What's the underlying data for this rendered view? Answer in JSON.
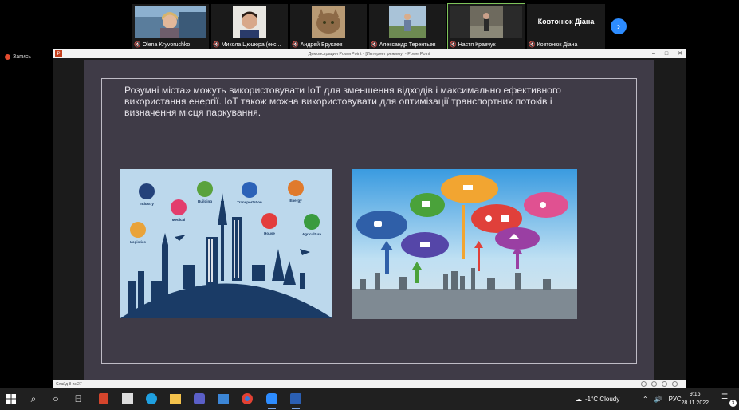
{
  "participants": [
    {
      "name": "Olena Kryvoruchko",
      "muted": true
    },
    {
      "name": "Микола Цюцюра (екс...",
      "muted": true
    },
    {
      "name": "Андрей Брукаев",
      "muted": true
    },
    {
      "name": "Александр Терентьев",
      "muted": true
    },
    {
      "name": "Настя Кравчук",
      "muted": true
    }
  ],
  "highlighted_participant": {
    "big_name": "Ковтонюк Діана",
    "small_name": "Ковтонюк Діана"
  },
  "record_label": "Запись",
  "ppt": {
    "window_title": "Демонстрация PowerPoint - [Интернет режиму] - PowerPoint",
    "status_text": "Слайд 8 из 27",
    "slide_text": "Розумні міста» можуть використовувати IoT для зменшення відходів і максимально ефективного використання енергії. IoT також можна використовувати для оптимізації транспортних потоків і визначення місця паркування.",
    "left_image_labels": {
      "industry": "Industry",
      "building": "Building",
      "transportation": "Transportation",
      "energy": "Energy",
      "medical": "Medical",
      "house": "House",
      "logistics": "Logistics",
      "agriculture": "Agriculture"
    }
  },
  "taskbar": {
    "weather": "-1°C Cloudy",
    "language": "РУС",
    "time": "9:16",
    "date": "28.11.2022",
    "notifications": "3"
  },
  "colors": {
    "slide_bg": "#3f3b47",
    "zoom_blue": "#2d8cff",
    "ppt_red": "#c43e1c"
  }
}
